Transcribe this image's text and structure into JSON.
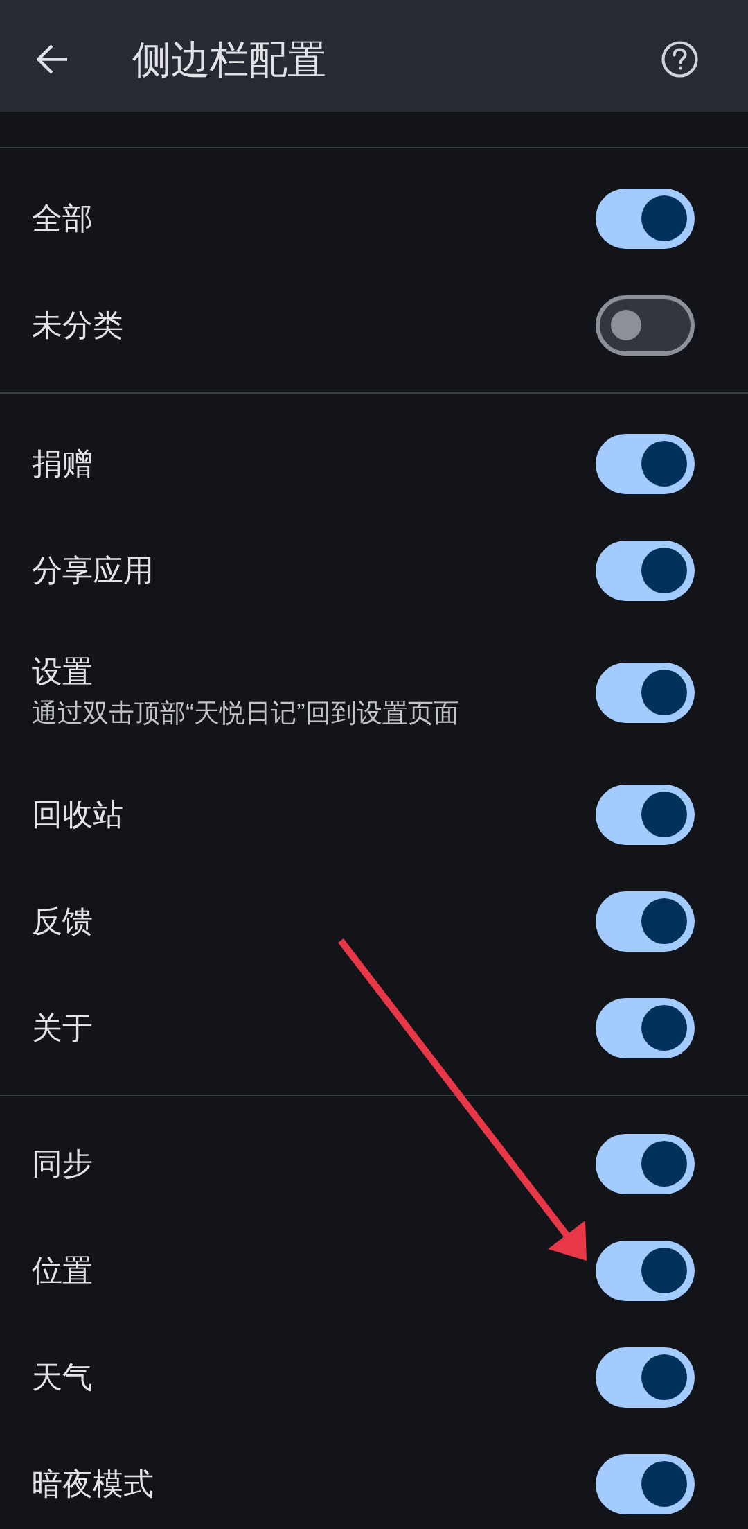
{
  "app_bar": {
    "title": "侧边栏配置"
  },
  "sections": [
    {
      "items": [
        {
          "label": "全部",
          "on": true
        },
        {
          "label": "未分类",
          "on": false
        }
      ]
    },
    {
      "items": [
        {
          "label": "捐赠",
          "on": true
        },
        {
          "label": "分享应用",
          "on": true
        },
        {
          "label": "设置",
          "description": "通过双击顶部“天悦日记”回到设置页面",
          "on": true
        },
        {
          "label": "回收站",
          "on": true
        },
        {
          "label": "反馈",
          "on": true
        },
        {
          "label": "关于",
          "on": true
        }
      ]
    },
    {
      "items": [
        {
          "label": "同步",
          "on": true
        },
        {
          "label": "位置",
          "on": true
        },
        {
          "label": "天气",
          "on": true
        },
        {
          "label": "暗夜模式",
          "on": true
        }
      ]
    }
  ],
  "annotation": {
    "kind": "arrow"
  }
}
